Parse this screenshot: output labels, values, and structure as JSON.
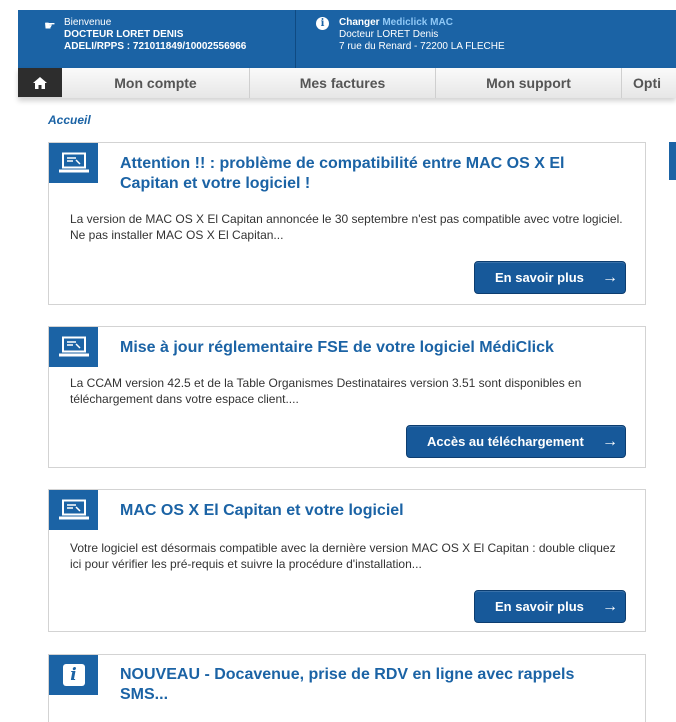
{
  "header": {
    "welcome_label": "Bienvenue",
    "user_name": "DOCTEUR LORET DENIS",
    "ids": "ADELI/RPPS : 721011849/10002556966",
    "change_prefix": "Changer ",
    "change_app": "Mediclick MAC",
    "doctor": "Docteur LORET Denis",
    "address": "7 rue du Renard - 72200 LA FLECHE"
  },
  "nav": {
    "tabs": [
      {
        "label": "Mon compte"
      },
      {
        "label": "Mes factures"
      },
      {
        "label": "Mon support"
      },
      {
        "label": "Opti"
      }
    ]
  },
  "breadcrumb": "Accueil",
  "cards": [
    {
      "icon": "laptop-icon",
      "title": "Attention !! : problème de compatibilité entre MAC OS X El Capitan et votre logiciel !",
      "description": "La version de MAC OS X El Capitan annoncée le 30 septembre n'est pas compatible avec votre logiciel. Ne pas installer MAC OS X El Capitan...",
      "button": "En savoir plus"
    },
    {
      "icon": "laptop-icon",
      "title": "Mise à jour réglementaire FSE de votre logiciel MédiClick",
      "description": "La CCAM version 42.5 et de la Table Organismes Destinataires version 3.51 sont disponibles en téléchargement dans votre espace client....",
      "button": "Accès au téléchargement"
    },
    {
      "icon": "laptop-icon",
      "title": "MAC OS X El Capitan et votre logiciel",
      "description": "Votre logiciel est désormais compatible avec la dernière version MAC OS X El Capitan : double cliquez ici pour vérifier les pré-requis et suivre la procédure d'installation...",
      "button": "En savoir plus"
    },
    {
      "icon": "info-icon",
      "icon_glyph": "i",
      "title": "NOUVEAU - Docavenue, prise de RDV en ligne avec rappels SMS..."
    }
  ],
  "colors": {
    "brand": "#1b63a5",
    "button": "#17599a"
  }
}
